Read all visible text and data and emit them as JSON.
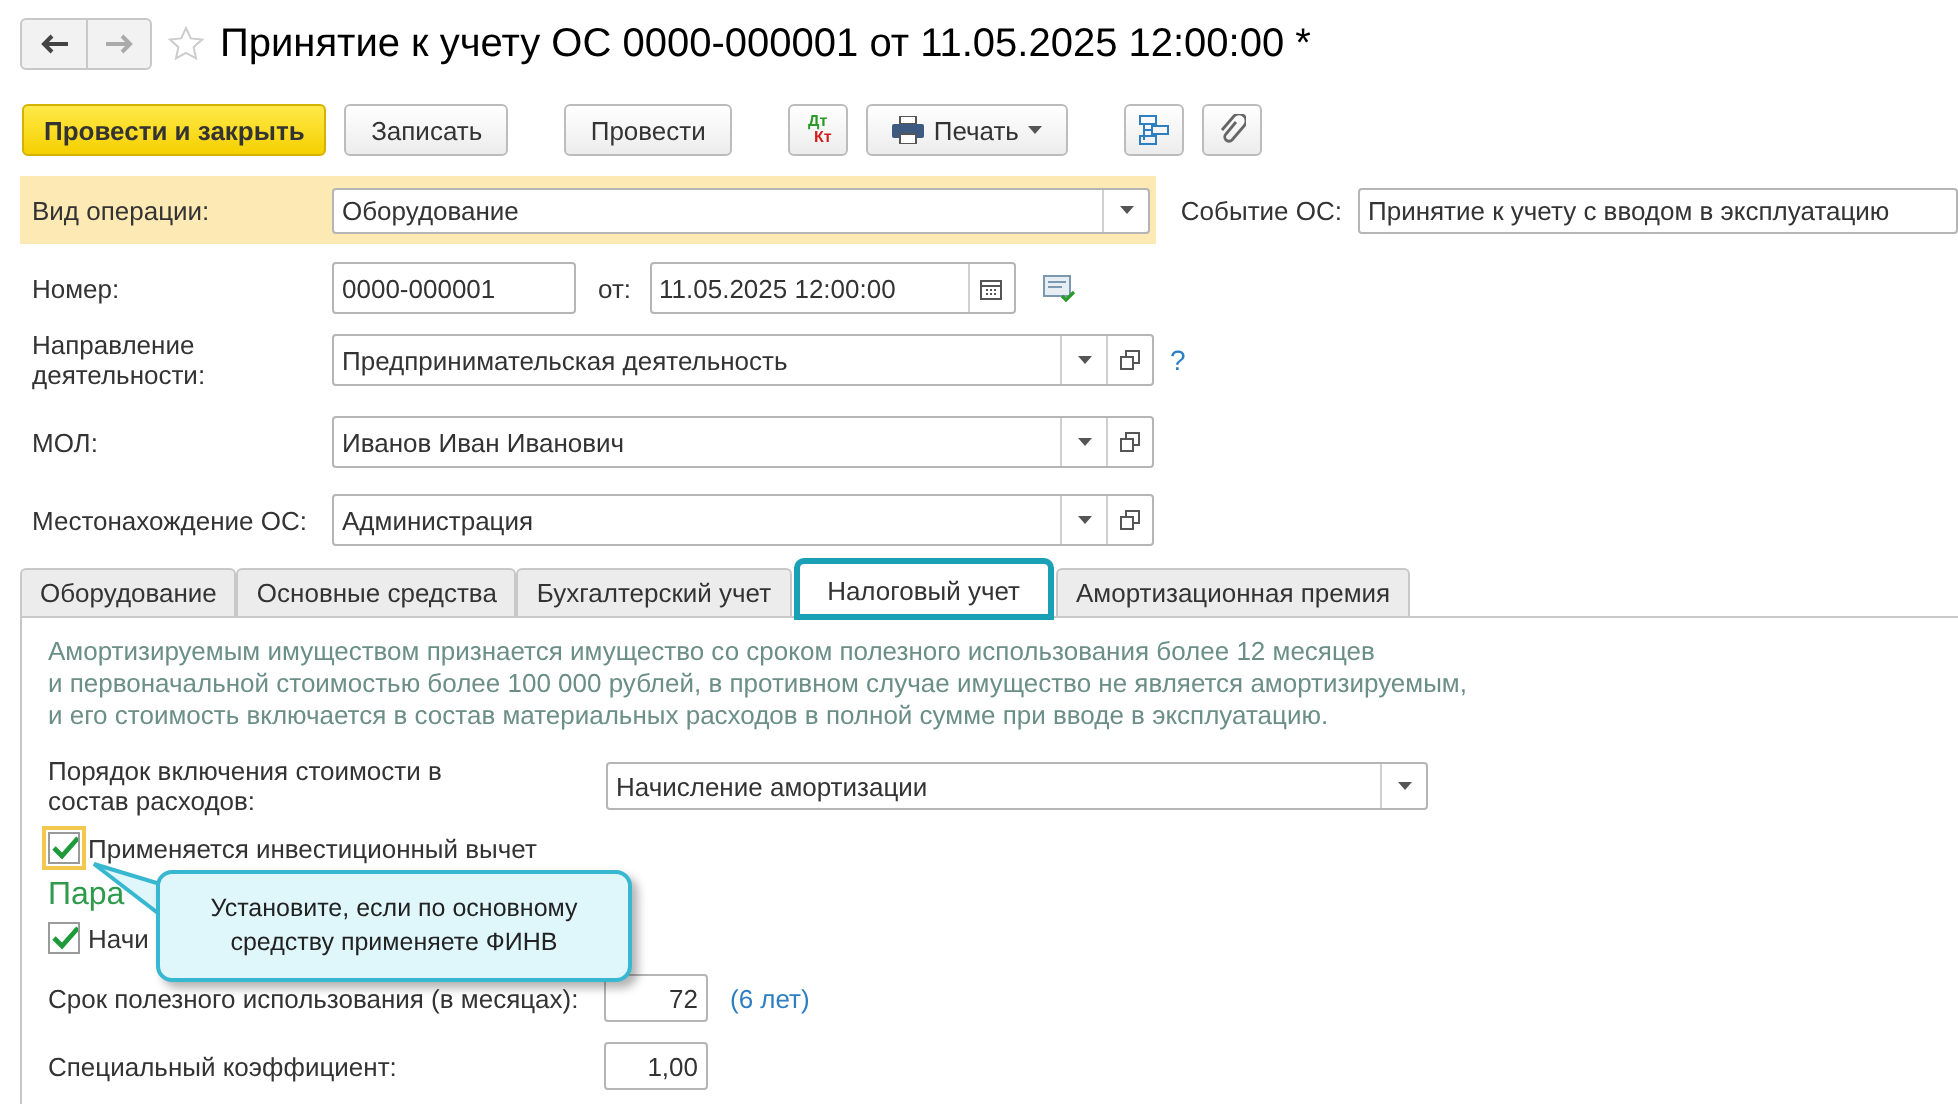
{
  "window": {
    "title": "Принятие к учету ОС 0000-000001 от 11.05.2025 12:00:00 *",
    "favorite": false
  },
  "toolbar": {
    "buttons": [
      {
        "kind": "primary",
        "label": "Провести и закрыть"
      },
      {
        "kind": "text",
        "label": "Записать"
      },
      {
        "kind": "text",
        "label": "Провести"
      },
      {
        "kind": "dtkt",
        "debit": "Дт",
        "credit": "Кт"
      },
      {
        "kind": "print",
        "label": "Печать"
      },
      {
        "kind": "structure"
      },
      {
        "kind": "attach"
      }
    ]
  },
  "operation": {
    "label": "Вид операции:",
    "value": "Оборудование"
  },
  "event": {
    "label": "Событие ОС:",
    "value": "Принятие к учету с вводом в эксплуатацию"
  },
  "number": {
    "label": "Номер:",
    "value": "0000-000001",
    "date_label": "от:",
    "date": "11.05.2025 12:00:00"
  },
  "refs": [
    {
      "label": "Направление деятельности:",
      "value": "Предпринимательская деятельность",
      "help": "?"
    },
    {
      "label": "МОЛ:",
      "value": "Иванов Иван Иванович"
    },
    {
      "label": "Местонахождение ОС:",
      "value": "Администрация"
    }
  ],
  "tabs": [
    {
      "label": "Оборудование",
      "selected": false
    },
    {
      "label": "Основные средства",
      "selected": false
    },
    {
      "label": "Бухгалтерский учет",
      "selected": false
    },
    {
      "label": "Налоговый учет",
      "selected": true
    },
    {
      "label": "Амортизационная премия",
      "selected": false
    }
  ],
  "tax": {
    "info": [
      "Амортизируемым имуществом признается имущество со сроком полезного использования более 12 месяцев",
      "и первоначальной стоимостью более 100 000 рублей, в противном случае имущество не является амортизируемым,",
      "и его стоимость включается в состав материальных расходов в полной сумме при вводе в эксплуатацию."
    ],
    "order": {
      "label": "Порядок включения стоимости в состав расходов:",
      "value": "Начисление амортизации"
    },
    "investment": {
      "label": "Применяется инвестиционный вычет",
      "checked": true
    },
    "section": "Пара",
    "accrue": {
      "label": "Начи",
      "checked": true
    },
    "life": {
      "label": "Срок полезного использования (в месяцах):",
      "value": "72",
      "note": "(6 лет)"
    },
    "coef": {
      "label": "Специальный коэффициент:",
      "value": "1,00"
    }
  },
  "tooltip": {
    "text": "Установите, если по основному средству применяете ФИНВ"
  }
}
